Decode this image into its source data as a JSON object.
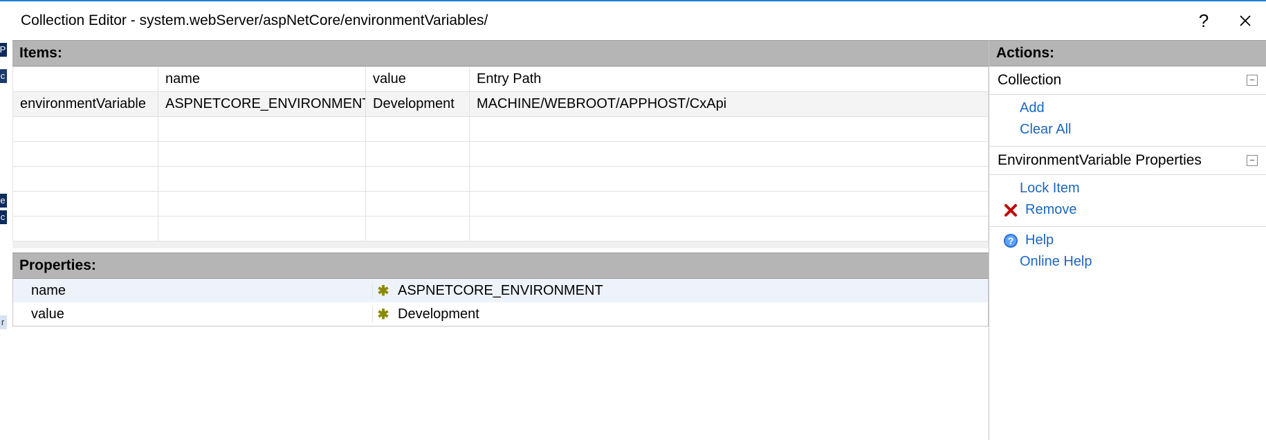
{
  "window": {
    "title": "Collection Editor - system.webServer/aspNetCore/environmentVariables/"
  },
  "items": {
    "title": "Items:",
    "columns": {
      "type": "",
      "name": "name",
      "value": "value",
      "entrypath": "Entry Path"
    },
    "rows": [
      {
        "type": "environmentVariable",
        "name": "ASPNETCORE_ENVIRONMENT",
        "value": "Development",
        "entrypath": "MACHINE/WEBROOT/APPHOST/CxApi"
      }
    ]
  },
  "properties": {
    "title": "Properties:",
    "rows": [
      {
        "name": "name",
        "value": "ASPNETCORE_ENVIRONMENT"
      },
      {
        "name": "value",
        "value": "Development"
      }
    ]
  },
  "actions": {
    "title": "Actions:",
    "groups": {
      "collection": {
        "title": "Collection",
        "links": {
          "add": "Add",
          "clearall": "Clear All"
        }
      },
      "envprops": {
        "title": "EnvironmentVariable Properties",
        "links": {
          "lockitem": "Lock Item",
          "remove": "Remove"
        }
      }
    },
    "help": {
      "help": "Help",
      "online": "Online Help"
    }
  }
}
